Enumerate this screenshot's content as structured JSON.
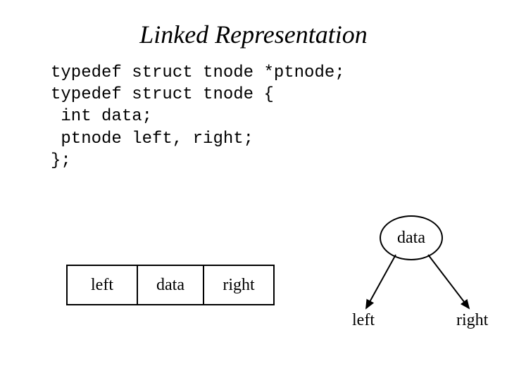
{
  "title": "Linked Representation",
  "code": {
    "line1": "typedef struct tnode *ptnode;",
    "line2": "typedef struct tnode {",
    "line3": " int data;",
    "line4": " ptnode left, right;",
    "line5": "};"
  },
  "box": {
    "left": "left",
    "data": "data",
    "right": "right"
  },
  "tree": {
    "node": "data",
    "leftChild": "left",
    "rightChild": "right"
  }
}
